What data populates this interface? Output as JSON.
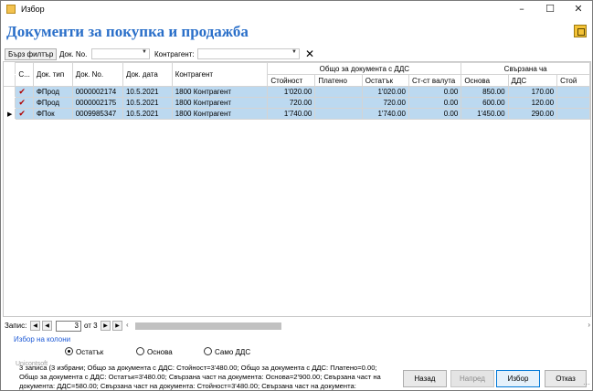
{
  "window": {
    "title": "Избор"
  },
  "heading": "Документи за покупка и продажба",
  "filterbar": {
    "quick_filter_label": "Бърз филтър",
    "doc_no_label": "Док. No.",
    "doc_no_value": "",
    "contractor_label": "Контрагент:",
    "contractor_value": ""
  },
  "grid": {
    "group_headers": [
      "Общо за документа с ДДС",
      "Свързана ча"
    ],
    "columns": [
      "С...",
      "Док. тип",
      "Док. No.",
      "Док. дата",
      "Контрагент",
      "Стойност",
      "Платено",
      "Остатък",
      "Ст-ст валута",
      "Основа",
      "ДДС",
      "Стой"
    ],
    "rows": [
      {
        "checked": true,
        "doc_type": "ФПрод",
        "doc_no": "0000002174",
        "doc_date": "10.5.2021",
        "contractor": "1800 Контрагент",
        "value": "1'020.00",
        "paid": "",
        "remaining": "1'020.00",
        "currency_value": "0.00",
        "base": "850.00",
        "vat": "170.00",
        "value2": ""
      },
      {
        "checked": true,
        "doc_type": "ФПрод",
        "doc_no": "0000002175",
        "doc_date": "10.5.2021",
        "contractor": "1800 Контрагент",
        "value": "720.00",
        "paid": "",
        "remaining": "720.00",
        "currency_value": "0.00",
        "base": "600.00",
        "vat": "120.00",
        "value2": ""
      },
      {
        "checked": true,
        "doc_type": "ФПок",
        "doc_no": "0009985347",
        "doc_date": "10.5.2021",
        "contractor": "1800 Контрагент",
        "value": "1'740.00",
        "paid": "",
        "remaining": "1'740.00",
        "currency_value": "0.00",
        "base": "1'450.00",
        "vat": "290.00",
        "value2": ""
      }
    ]
  },
  "navigator": {
    "label": "Запис:",
    "current": "3",
    "of_text": "от 3"
  },
  "column_chooser_link": "Избор на колони",
  "radio_options": [
    {
      "label": "Остатък",
      "selected": true
    },
    {
      "label": "Основа",
      "selected": false
    },
    {
      "label": "Само ДДС",
      "selected": false
    }
  ],
  "brand": "Unicontsoft",
  "summary_text": "3 записа (3 избрани; Общо за документа с ДДС: Стойност=3'480.00; Общо за документа с ДДС: Платено=0.00; Общо за документа с ДДС: Остатък=3'480.00; Свързана част на документа: Основа=2'900.00; Свързана част на документа: ДДС=580.00; Свързана част на документа: Стойност=3'480.00; Свързана част на документа:",
  "buttons": {
    "back": "Назад",
    "next": "Напред",
    "select": "Избор",
    "cancel": "Отказ"
  },
  "colors": {
    "heading": "#2a6fc9",
    "selection": "#bcd9f0",
    "check": "#b00000",
    "link": "#1f5bd6"
  }
}
